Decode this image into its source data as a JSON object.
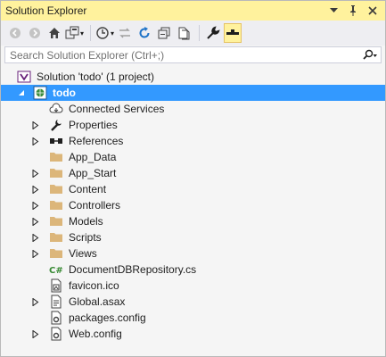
{
  "window": {
    "title": "Solution Explorer"
  },
  "search": {
    "placeholder": "Search Solution Explorer (Ctrl+;)"
  },
  "tree": {
    "solution": "Solution 'todo' (1 project)",
    "project": "todo",
    "items": [
      {
        "label": "Connected Services",
        "icon": "cloud-icon",
        "expandable": false
      },
      {
        "label": "Properties",
        "icon": "wrench-icon",
        "expandable": true
      },
      {
        "label": "References",
        "icon": "references-icon",
        "expandable": true
      },
      {
        "label": "App_Data",
        "icon": "folder-icon",
        "expandable": false
      },
      {
        "label": "App_Start",
        "icon": "folder-icon",
        "expandable": true
      },
      {
        "label": "Content",
        "icon": "folder-icon",
        "expandable": true
      },
      {
        "label": "Controllers",
        "icon": "folder-icon",
        "expandable": true
      },
      {
        "label": "Models",
        "icon": "folder-icon",
        "expandable": true
      },
      {
        "label": "Scripts",
        "icon": "folder-icon",
        "expandable": true
      },
      {
        "label": "Views",
        "icon": "folder-icon",
        "expandable": true
      },
      {
        "label": "DocumentDBRepository.cs",
        "icon": "csharp-file-icon",
        "expandable": false
      },
      {
        "label": "favicon.ico",
        "icon": "ico-file-icon",
        "expandable": false
      },
      {
        "label": "Global.asax",
        "icon": "asax-file-icon",
        "expandable": true
      },
      {
        "label": "packages.config",
        "icon": "config-file-icon",
        "expandable": false
      },
      {
        "label": "Web.config",
        "icon": "config-file-icon",
        "expandable": true
      }
    ]
  },
  "colors": {
    "title_bar": "#fff29d",
    "selection": "#3399ff",
    "folder": "#dcb67a"
  }
}
